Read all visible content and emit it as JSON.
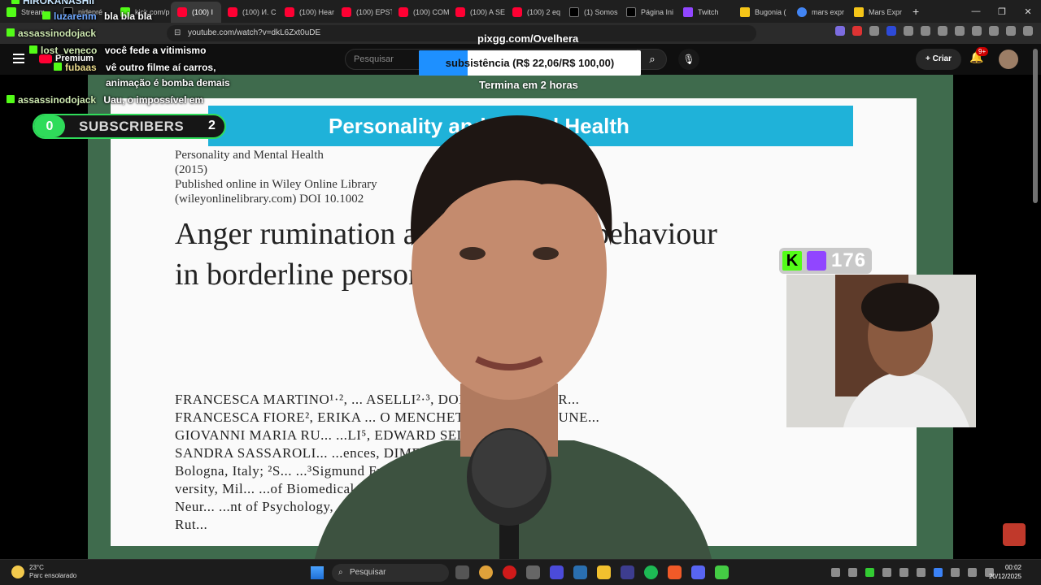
{
  "browser": {
    "tabs": [
      {
        "label": "Stream",
        "icon": "kick"
      },
      {
        "label": "nidepré",
        "icon": "x"
      },
      {
        "label": "kick.com/p",
        "icon": "kick"
      },
      {
        "label": "(100) I",
        "icon": "youtube",
        "active": true
      },
      {
        "label": "(100) И. С",
        "icon": "youtube"
      },
      {
        "label": "(100) Hear",
        "icon": "youtube"
      },
      {
        "label": "(100) EPST",
        "icon": "youtube"
      },
      {
        "label": "(100) COM",
        "icon": "youtube"
      },
      {
        "label": "(100) A SE",
        "icon": "youtube"
      },
      {
        "label": "(100) 2 eq",
        "icon": "youtube"
      },
      {
        "label": "(1) Somos",
        "icon": "x"
      },
      {
        "label": "Página Ini",
        "icon": "x"
      },
      {
        "label": "Twitch",
        "icon": "twitch"
      },
      {
        "label": "Bugonia (",
        "icon": "imdb"
      },
      {
        "label": "mars expr",
        "icon": "google"
      },
      {
        "label": "Mars Expr",
        "icon": "imdb"
      }
    ],
    "new_tab_glyph": "+",
    "window_controls": [
      "—",
      "❐",
      "✕"
    ],
    "url": "youtube.com/watch?v=dkL6Zxt0uDE"
  },
  "youtube": {
    "logo_label": "Premium",
    "search_placeholder": "Pesquisar",
    "search_glyph": "⌕",
    "mic_glyph": "🎙",
    "create_label": "Criar",
    "notifications_badge": "9+"
  },
  "overlay": {
    "pix_handle": "pixgg.com/Ovelhera",
    "goal_text": "subsistência (R$ 22,06/R$ 100,00)",
    "goal_progress": 0.2206,
    "goal_subtext": "Termina em 2 horas",
    "subscribers_count": "0",
    "subscribers_label": "SUBSCRIBERS",
    "subscribers_goal": "2",
    "viewer_count": "176"
  },
  "chat": [
    {
      "user": "HIROKANASHII",
      "message": "",
      "color": "u"
    },
    {
      "user": "luzarenm",
      "message": "bla bla bla",
      "color": "b"
    },
    {
      "user": "assassinodojack",
      "message": "",
      "color": "g"
    },
    {
      "user": "lost_veneco",
      "message": "você fede a vitimismo",
      "color": "g"
    },
    {
      "user": "fubaas",
      "message": "vê outro filme aí carros,",
      "color": "y"
    },
    {
      "user": "",
      "message": "animação é bomba demais",
      "color": "y"
    },
    {
      "user": "assassinodojack",
      "message": "Uau, o impossível em",
      "color": "g"
    }
  ],
  "paper": {
    "banner": "Personality and Mental Health",
    "meta": [
      "Personality and Mental Health",
      "(2015)",
      "Published online in Wiley Online Library",
      "(wileyonlinelibrary.com) DOI 10.1002"
    ],
    "title_line1": "Anger rumination and aggressive behaviour",
    "title_line2": "in borderline personality disorder",
    "authors": [
      "FRANCESCA MARTINO¹·², ... ASELLI²·³, DOMENICO BERAR...",
      "FRANCESCA FIORE², ERIKA ... O MENCHETTI¹, ELENA PRUNE...",
      "GIOVANNI MARIA RU... ...LI⁵, EDWARD SELBY⁶ AND",
      "SANDRA SASSAROLI... ...ences, DIMEC, University of",
      "Bologna, Italy; ²S... ...³Sigmund Freud Uni-",
      "versity, Mil... ...of Biomedical and",
      "Neur... ...nt of Psychology,",
      "Rut..."
    ]
  },
  "taskbar": {
    "temperature": "23°C",
    "weather": "Parc ensolarado",
    "search_label": "Pesquisar",
    "time": "00:02",
    "date": "20/12/2025"
  }
}
